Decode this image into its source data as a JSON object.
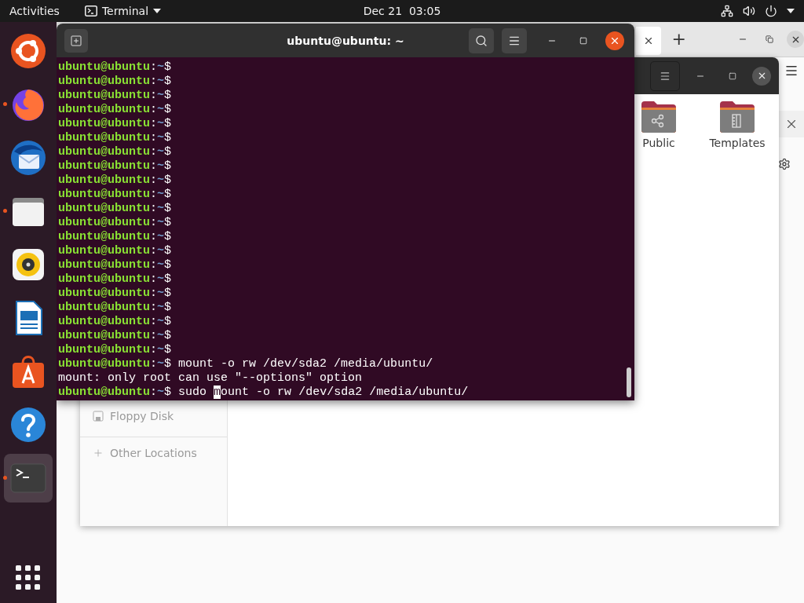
{
  "top_bar": {
    "activities": "Activities",
    "app_menu": "Terminal",
    "clock": "Dec 21  03:05"
  },
  "dock": {
    "items": [
      {
        "kind": "ubuntu",
        "running": false,
        "selected": false
      },
      {
        "kind": "firefox",
        "running": true,
        "selected": false
      },
      {
        "kind": "mail",
        "running": false,
        "selected": false
      },
      {
        "kind": "files",
        "running": true,
        "selected": false
      },
      {
        "kind": "music",
        "running": false,
        "selected": false
      },
      {
        "kind": "writer",
        "running": false,
        "selected": false
      },
      {
        "kind": "software",
        "running": false,
        "selected": false
      },
      {
        "kind": "help",
        "running": false,
        "selected": false
      },
      {
        "kind": "terminal",
        "running": true,
        "selected": true
      }
    ]
  },
  "browser_window": {
    "new_tab": "+"
  },
  "files_window": {
    "places": [
      {
        "label": "Floppy Disk",
        "kind": "drive"
      },
      {
        "label": "Other Locations",
        "kind": "other"
      }
    ],
    "folders": [
      {
        "label": "Public",
        "kind": "share"
      },
      {
        "label": "Templates",
        "kind": "templates"
      }
    ]
  },
  "terminal": {
    "title": "ubuntu@ubuntu: ~",
    "lines": [
      {
        "kind": "prompt",
        "user": "ubuntu@ubuntu",
        "sep": ":",
        "path": "~",
        "symbol": "$"
      },
      {
        "kind": "prompt",
        "user": "ubuntu@ubuntu",
        "sep": ":",
        "path": "~",
        "symbol": "$"
      },
      {
        "kind": "prompt",
        "user": "ubuntu@ubuntu",
        "sep": ":",
        "path": "~",
        "symbol": "$"
      },
      {
        "kind": "prompt",
        "user": "ubuntu@ubuntu",
        "sep": ":",
        "path": "~",
        "symbol": "$"
      },
      {
        "kind": "prompt",
        "user": "ubuntu@ubuntu",
        "sep": ":",
        "path": "~",
        "symbol": "$"
      },
      {
        "kind": "prompt",
        "user": "ubuntu@ubuntu",
        "sep": ":",
        "path": "~",
        "symbol": "$"
      },
      {
        "kind": "prompt",
        "user": "ubuntu@ubuntu",
        "sep": ":",
        "path": "~",
        "symbol": "$"
      },
      {
        "kind": "prompt",
        "user": "ubuntu@ubuntu",
        "sep": ":",
        "path": "~",
        "symbol": "$"
      },
      {
        "kind": "prompt",
        "user": "ubuntu@ubuntu",
        "sep": ":",
        "path": "~",
        "symbol": "$"
      },
      {
        "kind": "prompt",
        "user": "ubuntu@ubuntu",
        "sep": ":",
        "path": "~",
        "symbol": "$"
      },
      {
        "kind": "prompt",
        "user": "ubuntu@ubuntu",
        "sep": ":",
        "path": "~",
        "symbol": "$"
      },
      {
        "kind": "prompt",
        "user": "ubuntu@ubuntu",
        "sep": ":",
        "path": "~",
        "symbol": "$"
      },
      {
        "kind": "prompt",
        "user": "ubuntu@ubuntu",
        "sep": ":",
        "path": "~",
        "symbol": "$"
      },
      {
        "kind": "prompt",
        "user": "ubuntu@ubuntu",
        "sep": ":",
        "path": "~",
        "symbol": "$"
      },
      {
        "kind": "prompt",
        "user": "ubuntu@ubuntu",
        "sep": ":",
        "path": "~",
        "symbol": "$"
      },
      {
        "kind": "prompt",
        "user": "ubuntu@ubuntu",
        "sep": ":",
        "path": "~",
        "symbol": "$"
      },
      {
        "kind": "prompt",
        "user": "ubuntu@ubuntu",
        "sep": ":",
        "path": "~",
        "symbol": "$"
      },
      {
        "kind": "prompt",
        "user": "ubuntu@ubuntu",
        "sep": ":",
        "path": "~",
        "symbol": "$"
      },
      {
        "kind": "prompt",
        "user": "ubuntu@ubuntu",
        "sep": ":",
        "path": "~",
        "symbol": "$"
      },
      {
        "kind": "prompt",
        "user": "ubuntu@ubuntu",
        "sep": ":",
        "path": "~",
        "symbol": "$"
      },
      {
        "kind": "prompt",
        "user": "ubuntu@ubuntu",
        "sep": ":",
        "path": "~",
        "symbol": "$"
      },
      {
        "kind": "prompt",
        "user": "ubuntu@ubuntu",
        "sep": ":",
        "path": "~",
        "symbol": "$",
        "command": " mount -o rw /dev/sda2 /media/ubuntu/"
      },
      {
        "kind": "output",
        "text": "mount: only root can use \"--options\" option"
      },
      {
        "kind": "prompt",
        "user": "ubuntu@ubuntu",
        "sep": ":",
        "path": "~",
        "symbol": "$",
        "command": " sudo ",
        "cursor": "m",
        "rest": "ount -o rw /dev/sda2 /media/ubuntu/"
      }
    ]
  }
}
